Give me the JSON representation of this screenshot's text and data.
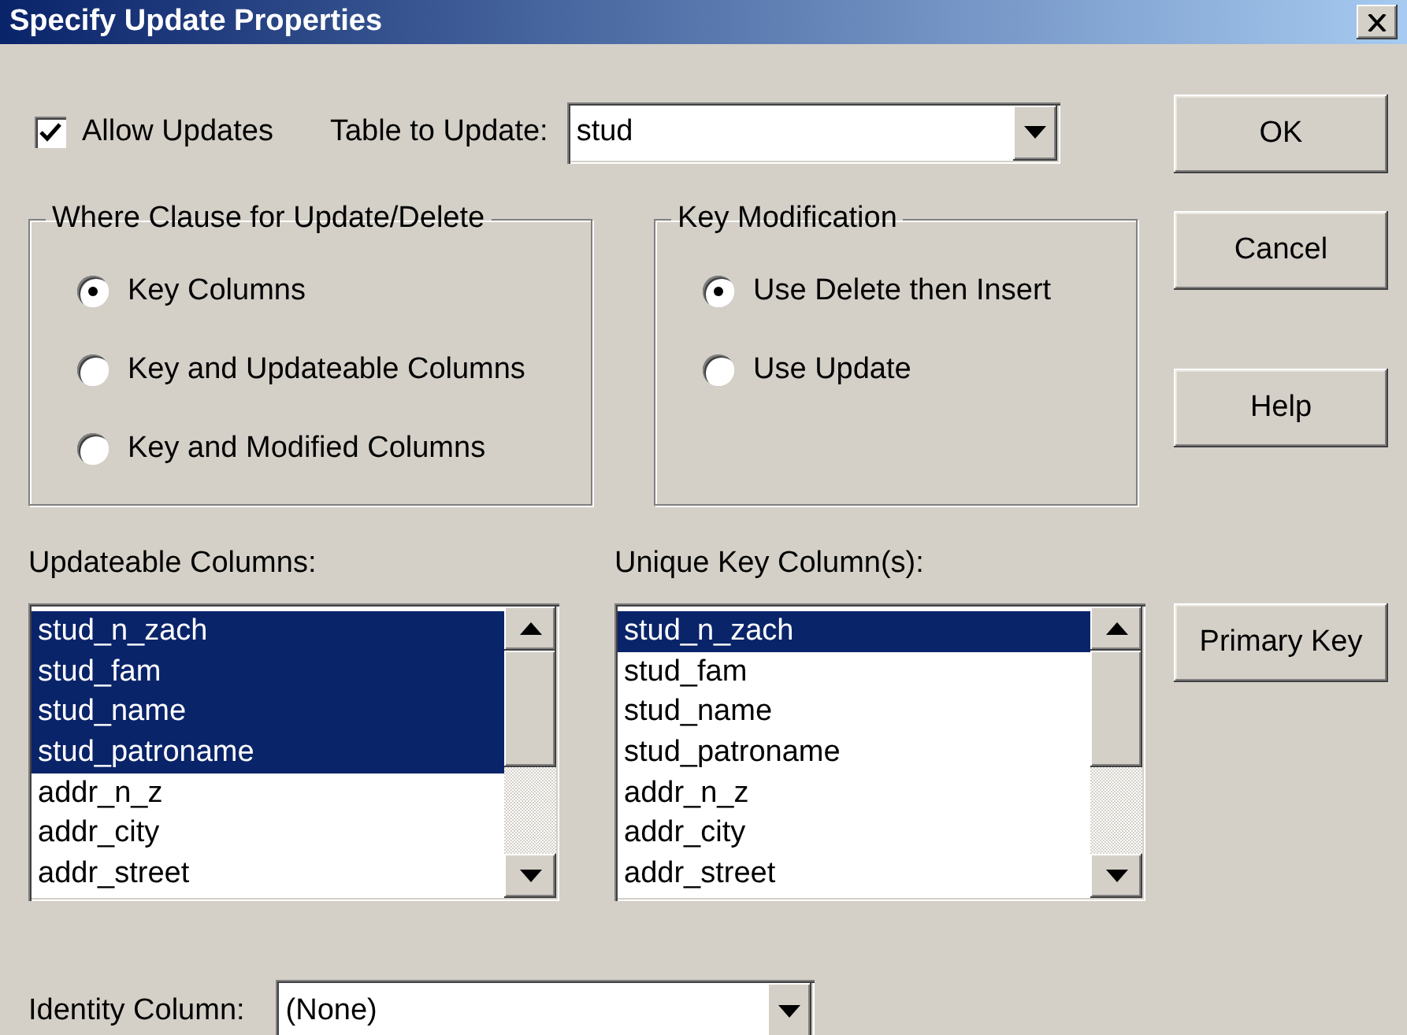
{
  "window": {
    "title": "Specify Update Properties"
  },
  "allow_updates": {
    "label": "Allow Updates",
    "checked": true
  },
  "table_to_update": {
    "label": "Table to Update:",
    "value": "stud"
  },
  "where_clause": {
    "title": "Where Clause for Update/Delete",
    "options": [
      {
        "label": "Key Columns",
        "selected": true
      },
      {
        "label": "Key and Updateable Columns",
        "selected": false
      },
      {
        "label": "Key and Modified Columns",
        "selected": false
      }
    ]
  },
  "key_modification": {
    "title": "Key Modification",
    "options": [
      {
        "label": "Use Delete then Insert",
        "selected": true
      },
      {
        "label": "Use Update",
        "selected": false
      }
    ]
  },
  "updateable_columns": {
    "label": "Updateable Columns:",
    "items": [
      {
        "label": "stud_n_zach",
        "selected": true
      },
      {
        "label": "stud_fam",
        "selected": true
      },
      {
        "label": "stud_name",
        "selected": true
      },
      {
        "label": "stud_patroname",
        "selected": true
      },
      {
        "label": "addr_n_z",
        "selected": false
      },
      {
        "label": "addr_city",
        "selected": false
      },
      {
        "label": "addr_street",
        "selected": false
      }
    ]
  },
  "unique_key_columns": {
    "label": "Unique Key Column(s):",
    "items": [
      {
        "label": "stud_n_zach",
        "selected": true
      },
      {
        "label": "stud_fam",
        "selected": false
      },
      {
        "label": "stud_name",
        "selected": false
      },
      {
        "label": "stud_patroname",
        "selected": false
      },
      {
        "label": "addr_n_z",
        "selected": false
      },
      {
        "label": "addr_city",
        "selected": false
      },
      {
        "label": "addr_street",
        "selected": false
      }
    ]
  },
  "identity_column": {
    "label": "Identity Column:",
    "value": "(None)"
  },
  "buttons": [
    {
      "label": "OK"
    },
    {
      "label": "Cancel"
    },
    {
      "label": "Help"
    },
    {
      "label": "Primary Key"
    }
  ]
}
